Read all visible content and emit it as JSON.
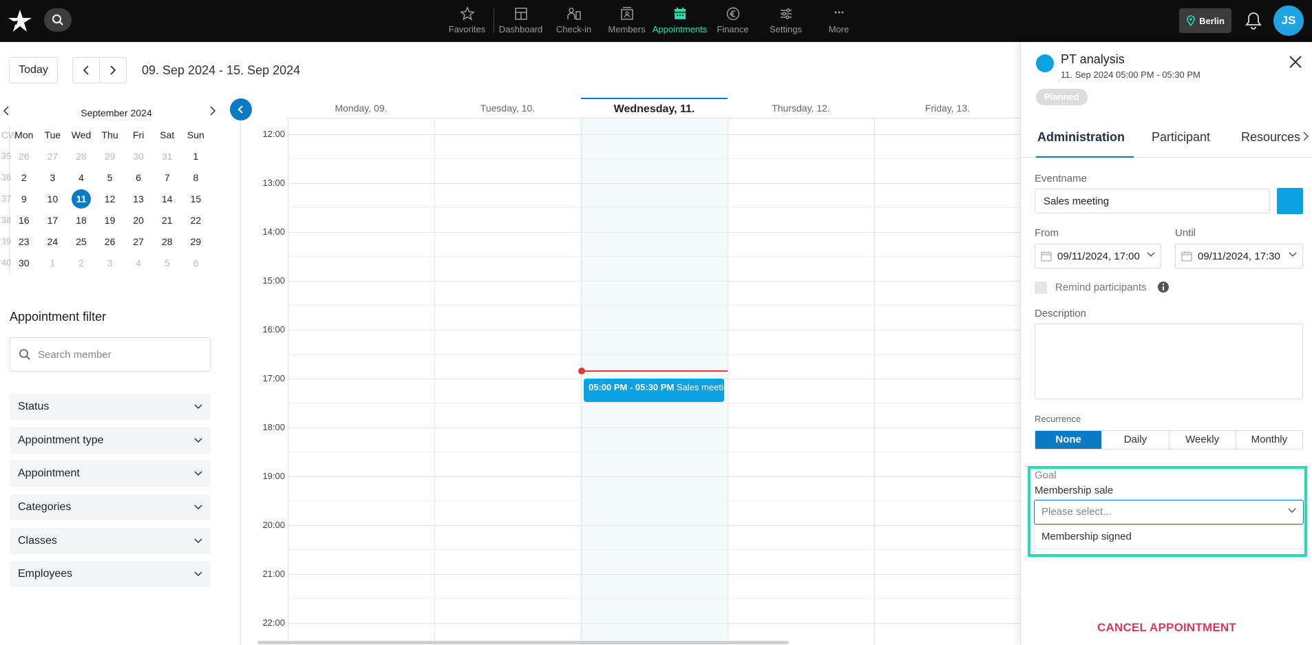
{
  "topbar": {
    "nav": [
      {
        "label": "Favorites",
        "icon": "star-icon"
      },
      {
        "label": "Dashboard",
        "icon": "dashboard-icon"
      },
      {
        "label": "Check-in",
        "icon": "check-in-icon"
      },
      {
        "label": "Members",
        "icon": "members-icon"
      },
      {
        "label": "Appointments",
        "icon": "calendar-icon",
        "active": true
      },
      {
        "label": "Finance",
        "icon": "euro-icon"
      },
      {
        "label": "Settings",
        "icon": "sliders-icon"
      },
      {
        "label": "More",
        "icon": "more-icon"
      }
    ],
    "location": "Berlin",
    "avatar": "JS",
    "accent": "#19e3b1"
  },
  "toolbar": {
    "today_label": "Today",
    "date_range": "09. Sep 2024 - 15. Sep 2024"
  },
  "mini_calendar": {
    "month": "September 2024",
    "cw_label": "CW",
    "weekdays": [
      "Mon",
      "Tue",
      "Wed",
      "Thu",
      "Fri",
      "Sat",
      "Sun"
    ],
    "weeks": [
      {
        "cw": "35",
        "days": [
          "26",
          "27",
          "28",
          "29",
          "30",
          "31",
          "1"
        ]
      },
      {
        "cw": "36",
        "days": [
          "2",
          "3",
          "4",
          "5",
          "6",
          "7",
          "8"
        ]
      },
      {
        "cw": "37",
        "days": [
          "9",
          "10",
          "11",
          "12",
          "13",
          "14",
          "15"
        ]
      },
      {
        "cw": "38",
        "days": [
          "16",
          "17",
          "18",
          "19",
          "20",
          "21",
          "22"
        ]
      },
      {
        "cw": "39",
        "days": [
          "23",
          "24",
          "25",
          "26",
          "27",
          "28",
          "29"
        ]
      },
      {
        "cw": "40",
        "days": [
          "30",
          "1",
          "2",
          "3",
          "4",
          "5",
          "6"
        ]
      }
    ],
    "today": "11"
  },
  "filters": {
    "title": "Appointment filter",
    "search_placeholder": "Search member",
    "items": [
      "Status",
      "Appointment type",
      "Appointment",
      "Categories",
      "Classes",
      "Employees"
    ]
  },
  "calendar": {
    "days": [
      "Monday, 09.",
      "Tuesday, 10.",
      "Wednesday, 11.",
      "Thursday, 12.",
      "Friday, 13."
    ],
    "hours": [
      "12:00",
      "13:00",
      "14:00",
      "15:00",
      "16:00",
      "17:00",
      "18:00",
      "19:00",
      "20:00",
      "21:00",
      "22:00"
    ],
    "event": {
      "time": "05:00 PM - 05:30 PM",
      "name": "Sales meeting",
      "color": "#0aa2e0"
    }
  },
  "panel": {
    "title": "PT analysis",
    "subtitle": "11. Sep 2024 05:00 PM - 05:30 PM",
    "badge": "Planned",
    "tabs": [
      "Administration",
      "Participant",
      "Resources"
    ],
    "eventname_label": "Eventname",
    "eventname_value": "Sales meeting",
    "from_label": "From",
    "from_value": "09/11/2024, 17:00",
    "until_label": "Until",
    "until_value": "09/11/2024, 17:30",
    "remind_label": "Remind participants",
    "description_label": "Description",
    "recurrence_label": "Recurrence",
    "recurrence_options": [
      "None",
      "Daily",
      "Weekly",
      "Monthly"
    ],
    "goal_label": "Goal",
    "goal_sub": "Membership sale",
    "goal_placeholder": "Please select...",
    "goal_option": "Membership signed",
    "cancel_label": "CANCEL APPOINTMENT"
  }
}
